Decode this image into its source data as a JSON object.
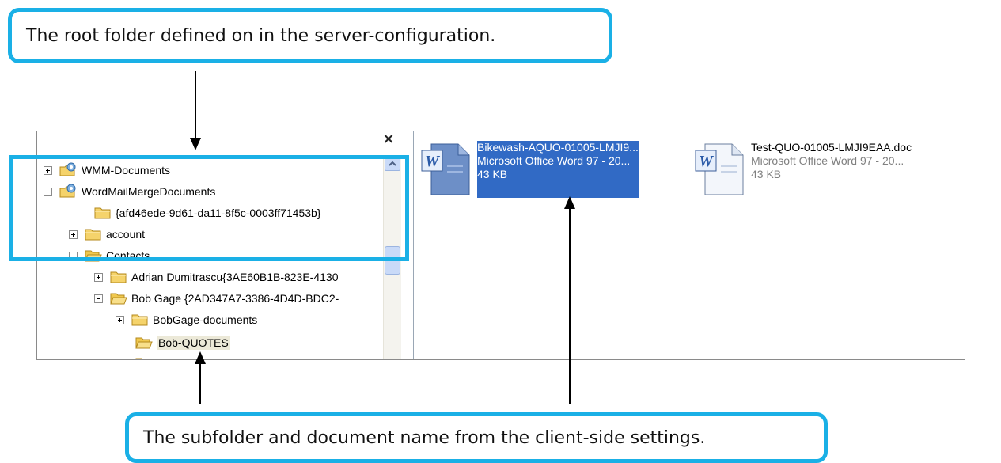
{
  "callouts": {
    "top": "The root folder defined on in the server-configuration.",
    "bottom": "The subfolder and document name from the client-side settings."
  },
  "tree": {
    "close_glyph": "×",
    "items": [
      {
        "label": "WMM-Documents",
        "expander": "plus",
        "icon": "gear-folder-icon"
      },
      {
        "label": "WordMailMergeDocuments",
        "expander": "minus",
        "icon": "gear-folder-icon"
      },
      {
        "label": "{afd46ede-9d61-da11-8f5c-0003ff71453b}",
        "expander": "none",
        "icon": "folder-icon"
      },
      {
        "label": "account",
        "expander": "plus",
        "icon": "folder-icon"
      },
      {
        "label": "Contacts",
        "expander": "minus",
        "icon": "folder-icon"
      },
      {
        "label": "Adrian Dumitrascu{3AE60B1B-823E-4130",
        "expander": "plus",
        "icon": "folder-icon"
      },
      {
        "label": "Bob Gage {2AD347A7-3386-4D4D-BDC2-",
        "expander": "minus",
        "icon": "folder-icon"
      },
      {
        "label": "BobGage-documents",
        "expander": "plus",
        "icon": "folder-icon"
      },
      {
        "label": "Bob-QUOTES",
        "expander": "none",
        "icon": "folder-icon",
        "selected": true
      }
    ]
  },
  "files": [
    {
      "name": "Bikewash-AQUO-01005-LMJI9...",
      "type": "Microsoft Office Word 97 - 20...",
      "size": "43 KB",
      "selected": true,
      "icon": "word-document-icon"
    },
    {
      "name": "Test-QUO-01005-LMJI9EAA.doc",
      "type": "Microsoft Office Word 97 - 20...",
      "size": "43 KB",
      "selected": false,
      "icon": "word-document-icon"
    }
  ],
  "colors": {
    "callout_border": "#1ab0e6",
    "selection": "#316ac5",
    "folder": "#f5d36b"
  }
}
